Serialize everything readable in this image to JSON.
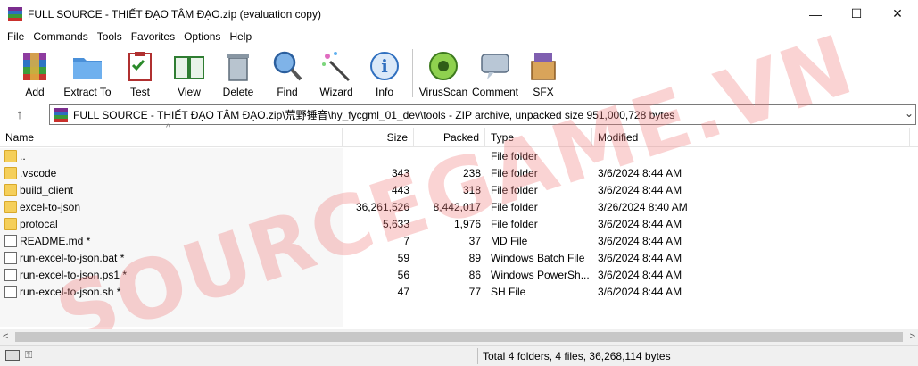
{
  "window": {
    "title": "FULL SOURCE - THIẾT ĐẠO TÂM ĐẠO.zip (evaluation copy)",
    "controls": {
      "minimize": "—",
      "maximize": "☐",
      "close": "✕"
    }
  },
  "menu": [
    "File",
    "Commands",
    "Tools",
    "Favorites",
    "Options",
    "Help"
  ],
  "toolbar": [
    {
      "label": "Add",
      "icon": "add-archive-icon"
    },
    {
      "label": "Extract To",
      "icon": "extract-folder-icon"
    },
    {
      "label": "Test",
      "icon": "test-clipboard-icon"
    },
    {
      "label": "View",
      "icon": "view-book-icon"
    },
    {
      "label": "Delete",
      "icon": "trash-bin-icon"
    },
    {
      "label": "Find",
      "icon": "magnifier-icon"
    },
    {
      "label": "Wizard",
      "icon": "magic-wand-icon"
    },
    {
      "label": "Info",
      "icon": "info-icon"
    },
    {
      "label": "VirusScan",
      "icon": "virus-scan-icon"
    },
    {
      "label": "Comment",
      "icon": "comment-icon"
    },
    {
      "label": "SFX",
      "icon": "sfx-box-icon"
    }
  ],
  "address": {
    "path": "FULL SOURCE - THIẾT ĐẠO TÂM ĐẠO.zip\\荒野锤音\\hy_fycgml_01_dev\\tools - ZIP archive, unpacked size 951,000,728 bytes",
    "up_glyph": "↑",
    "dropdown_glyph": "⌄"
  },
  "columns": {
    "name": "Name",
    "size": "Size",
    "packed": "Packed",
    "type": "Type",
    "modified": "Modified"
  },
  "rows": [
    {
      "name": "..",
      "size": "",
      "packed": "",
      "type": "File folder",
      "modified": "",
      "kind": "folder"
    },
    {
      "name": ".vscode",
      "size": "343",
      "packed": "238",
      "type": "File folder",
      "modified": "3/6/2024 8:44 AM",
      "kind": "folder"
    },
    {
      "name": "build_client",
      "size": "443",
      "packed": "318",
      "type": "File folder",
      "modified": "3/6/2024 8:44 AM",
      "kind": "folder"
    },
    {
      "name": "excel-to-json",
      "size": "36,261,526",
      "packed": "8,442,017",
      "type": "File folder",
      "modified": "3/26/2024 8:40 AM",
      "kind": "folder"
    },
    {
      "name": "protocal",
      "size": "5,633",
      "packed": "1,976",
      "type": "File folder",
      "modified": "3/6/2024 8:44 AM",
      "kind": "folder"
    },
    {
      "name": "README.md *",
      "size": "7",
      "packed": "37",
      "type": "MD File",
      "modified": "3/6/2024 8:44 AM",
      "kind": "file"
    },
    {
      "name": "run-excel-to-json.bat *",
      "size": "59",
      "packed": "89",
      "type": "Windows Batch File",
      "modified": "3/6/2024 8:44 AM",
      "kind": "file"
    },
    {
      "name": "run-excel-to-json.ps1 *",
      "size": "56",
      "packed": "86",
      "type": "Windows PowerSh...",
      "modified": "3/6/2024 8:44 AM",
      "kind": "file"
    },
    {
      "name": "run-excel-to-json.sh *",
      "size": "47",
      "packed": "77",
      "type": "SH File",
      "modified": "3/6/2024 8:44 AM",
      "kind": "file"
    }
  ],
  "watermark": "SOURCEGAME.VN",
  "status": {
    "text": "Total 4 folders, 4 files, 36,268,114 bytes"
  },
  "colors": {
    "folder": "#f5cf5a",
    "watermark": "#f07878"
  }
}
